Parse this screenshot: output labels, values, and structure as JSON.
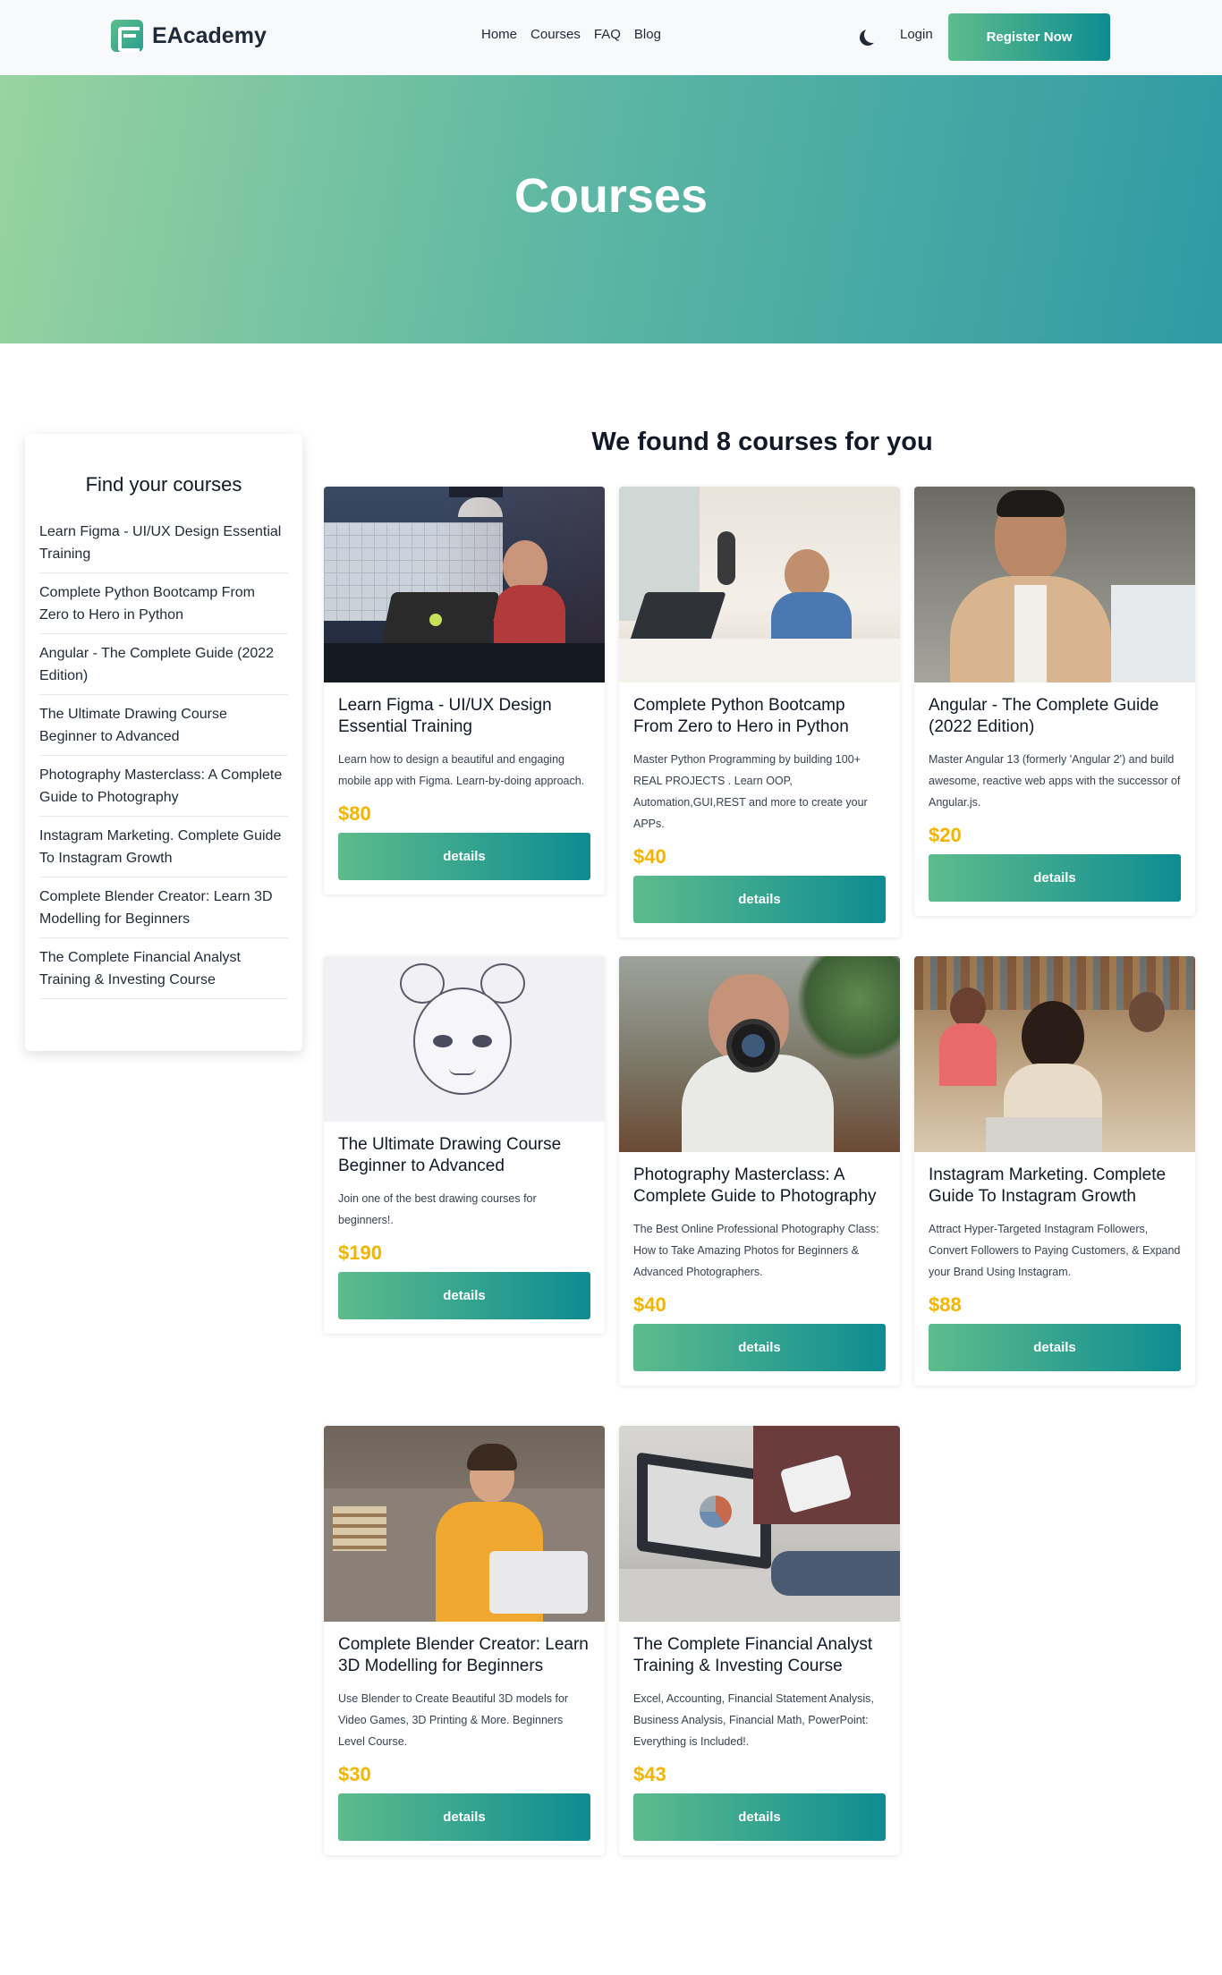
{
  "brand": {
    "name": "EAcademy"
  },
  "nav": {
    "items": [
      "Home",
      "Courses",
      "FAQ",
      "Blog"
    ],
    "login": "Login",
    "register": "Register Now"
  },
  "hero": {
    "title": "Courses"
  },
  "sidebar": {
    "title": "Find your courses",
    "items": [
      "Learn Figma - UI/UX Design Essential Training",
      "Complete Python Bootcamp From Zero to Hero in Python",
      "Angular - The Complete Guide (2022 Edition)",
      "The Ultimate Drawing Course Beginner to Advanced",
      "Photography Masterclass: A Complete Guide to Photography",
      "Instagram Marketing. Complete Guide To Instagram Growth",
      "Complete Blender Creator: Learn 3D Modelling for Beginners",
      "The Complete Financial Analyst Training & Investing Course"
    ]
  },
  "results": {
    "title": "We found 8 courses for you"
  },
  "colors": {
    "accent_start": "#5dbc8c",
    "accent_end": "#0e8c92",
    "price": "#f4b400"
  },
  "courses": [
    {
      "title": "Learn Figma - UI/UX Design Essential Training",
      "description": "Learn how to design a beautiful and engaging mobile app with Figma. Learn-by-doing approach.",
      "price": "$80",
      "button": "details"
    },
    {
      "title": "Complete Python Bootcamp From Zero to Hero in Python",
      "description": "Master Python Programming by building 100+ REAL PROJECTS . Learn OOP, Automation,GUI,REST and more to create your APPs.",
      "price": "$40",
      "button": "details"
    },
    {
      "title": "Angular - The Complete Guide (2022 Edition)",
      "description": "Master Angular 13 (formerly 'Angular 2') and build awesome, reactive web apps with the successor of Angular.js.",
      "price": "$20",
      "button": "details"
    },
    {
      "title": "The Ultimate Drawing Course Beginner to Advanced",
      "description": "Join one of the best drawing courses for beginners!.",
      "price": "$190",
      "button": "details"
    },
    {
      "title": "Photography Masterclass: A Complete Guide to Photography",
      "description": "The Best Online Professional Photography Class: How to Take Amazing Photos for Beginners & Advanced Photographers.",
      "price": "$40",
      "button": "details"
    },
    {
      "title": "Instagram Marketing. Complete Guide To Instagram Growth",
      "description": "Attract Hyper-Targeted Instagram Followers, Convert Followers to Paying Customers, & Expand your Brand Using Instagram.",
      "price": "$88",
      "button": "details"
    },
    {
      "title": "Complete Blender Creator: Learn 3D Modelling for Beginners",
      "description": "Use Blender to Create Beautiful 3D models for Video Games, 3D Printing & More. Beginners Level Course.",
      "price": "$30",
      "button": "details"
    },
    {
      "title": "The Complete Financial Analyst Training & Investing Course",
      "description": "Excel, Accounting, Financial Statement Analysis, Business Analysis, Financial Math, PowerPoint: Everything is Included!.",
      "price": "$43",
      "button": "details"
    }
  ]
}
